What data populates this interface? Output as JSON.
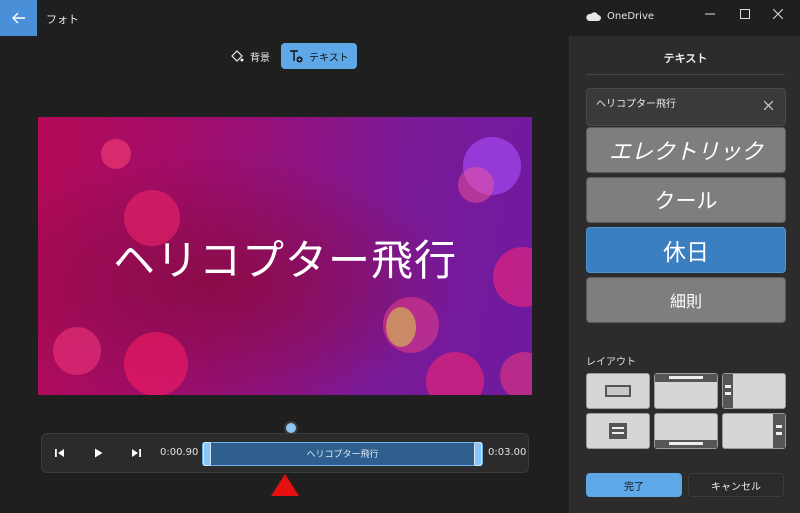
{
  "titlebar": {
    "app_title": "フォト",
    "onedrive_label": "OneDrive"
  },
  "toolbar": {
    "background_label": "背景",
    "text_label": "テキスト"
  },
  "preview": {
    "caption": "ヘリコプター飛行"
  },
  "timeline": {
    "start_time": "0:00.90",
    "end_time": "0:03.00",
    "clip_label": "ヘリコプター飛行"
  },
  "panel": {
    "title": "テキスト",
    "text_value": "ヘリコプター飛行",
    "styles": [
      {
        "label": "エレクトリック"
      },
      {
        "label": "クール"
      },
      {
        "label": "休日"
      },
      {
        "label": "細則"
      }
    ],
    "layout_label": "レイアウト",
    "done_label": "完了",
    "cancel_label": "キャンセル"
  },
  "colors": {
    "accent": "#5fa8e8",
    "selected_style": "#3a7fc1",
    "marker": "#e61010"
  }
}
